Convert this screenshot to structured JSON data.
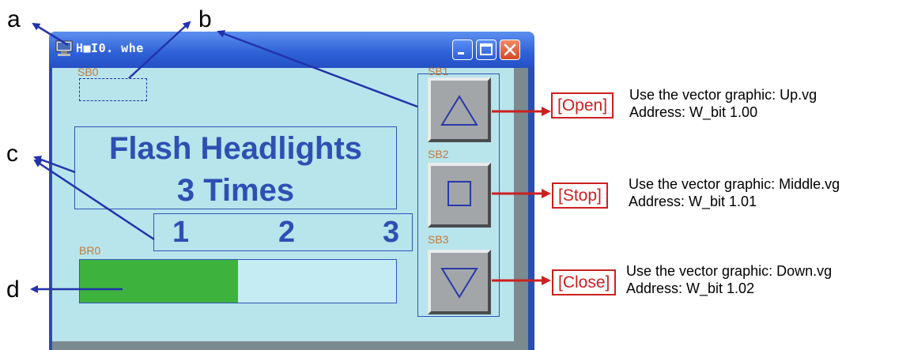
{
  "callouts": {
    "a": "a",
    "b": "b",
    "c": "c",
    "d": "d"
  },
  "window": {
    "title": "H■I0. whe"
  },
  "screen": {
    "sb0_tag": "SB0",
    "sb1_tag": "SB1",
    "sb2_tag": "SB2",
    "sb3_tag": "SB3",
    "br0_tag": "BR0",
    "message_line1": "Flash Headlights",
    "message_line2": "3 Times",
    "counter": [
      "1",
      "2",
      "3"
    ],
    "bar_fill_fraction": 0.5
  },
  "buttons": [
    {
      "label": "[Open]",
      "line1": "Use the vector graphic: Up.vg",
      "line2": "Address: W_bit 1.00",
      "icon": "triangle-up-icon"
    },
    {
      "label": "[Stop]",
      "line1": "Use the vector graphic: Middle.vg",
      "line2": "Address: W_bit 1.01",
      "icon": "square-icon"
    },
    {
      "label": "[Close]",
      "line1": "Use the vector graphic: Down.vg",
      "line2": "Address: W_bit 1.02",
      "icon": "triangle-down-icon"
    }
  ],
  "colors": {
    "annotation_red": "#cc2020",
    "annotation_blue": "#2233aa",
    "bar_green": "#3db23d",
    "screen_bg": "#b8e4ec"
  }
}
